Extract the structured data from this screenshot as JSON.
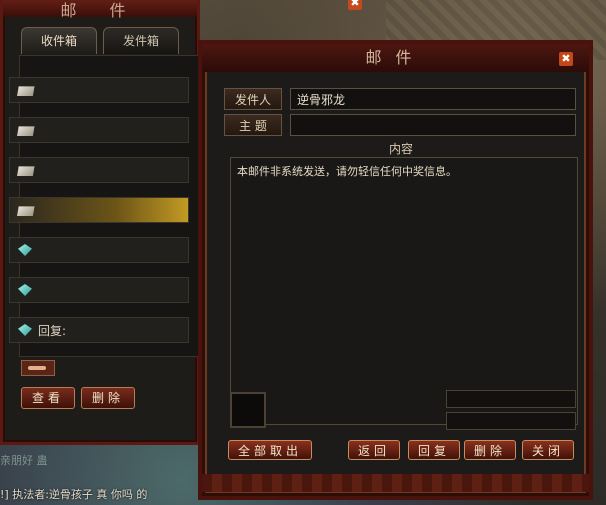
{
  "left_window": {
    "title": "邮 件",
    "close_glyph": "✖",
    "tabs": [
      {
        "label": "收件箱",
        "active": true
      },
      {
        "label": "发件箱",
        "active": false
      }
    ],
    "mails": [
      {
        "icon": "envelope-icon",
        "label": ""
      },
      {
        "icon": "envelope-icon",
        "label": ""
      },
      {
        "icon": "envelope-icon",
        "label": ""
      },
      {
        "icon": "envelope-icon",
        "label": "",
        "selected": true
      },
      {
        "icon": "gem-icon",
        "label": ""
      },
      {
        "icon": "gem-icon",
        "label": ""
      },
      {
        "icon": "gem-icon",
        "label": "回复:"
      }
    ],
    "buttons": {
      "view": "查看",
      "delete": "删除"
    }
  },
  "mail_window": {
    "title": "邮件",
    "close_glyph": "✖",
    "sender_label": "发件人",
    "sender_value": "逆骨邪龙",
    "subject_label": "主 题",
    "subject_value": "",
    "content_label": "内容",
    "content_text": "本邮件非系统发送，请勿轻信任何中奖信息。",
    "buttons": {
      "take_all": "全部取出",
      "back": "返回",
      "reply": "回复",
      "delete": "删除",
      "close": "关闭"
    }
  },
  "chat": {
    "line1": "!] 执法者:逆骨孩子  真  你吗 的",
    "line2": "亲朋好  蛊  "
  },
  "colors": {
    "frame_red": "#4a120c",
    "button_red": "#8a301d",
    "selected_gold": "#c39a24"
  }
}
